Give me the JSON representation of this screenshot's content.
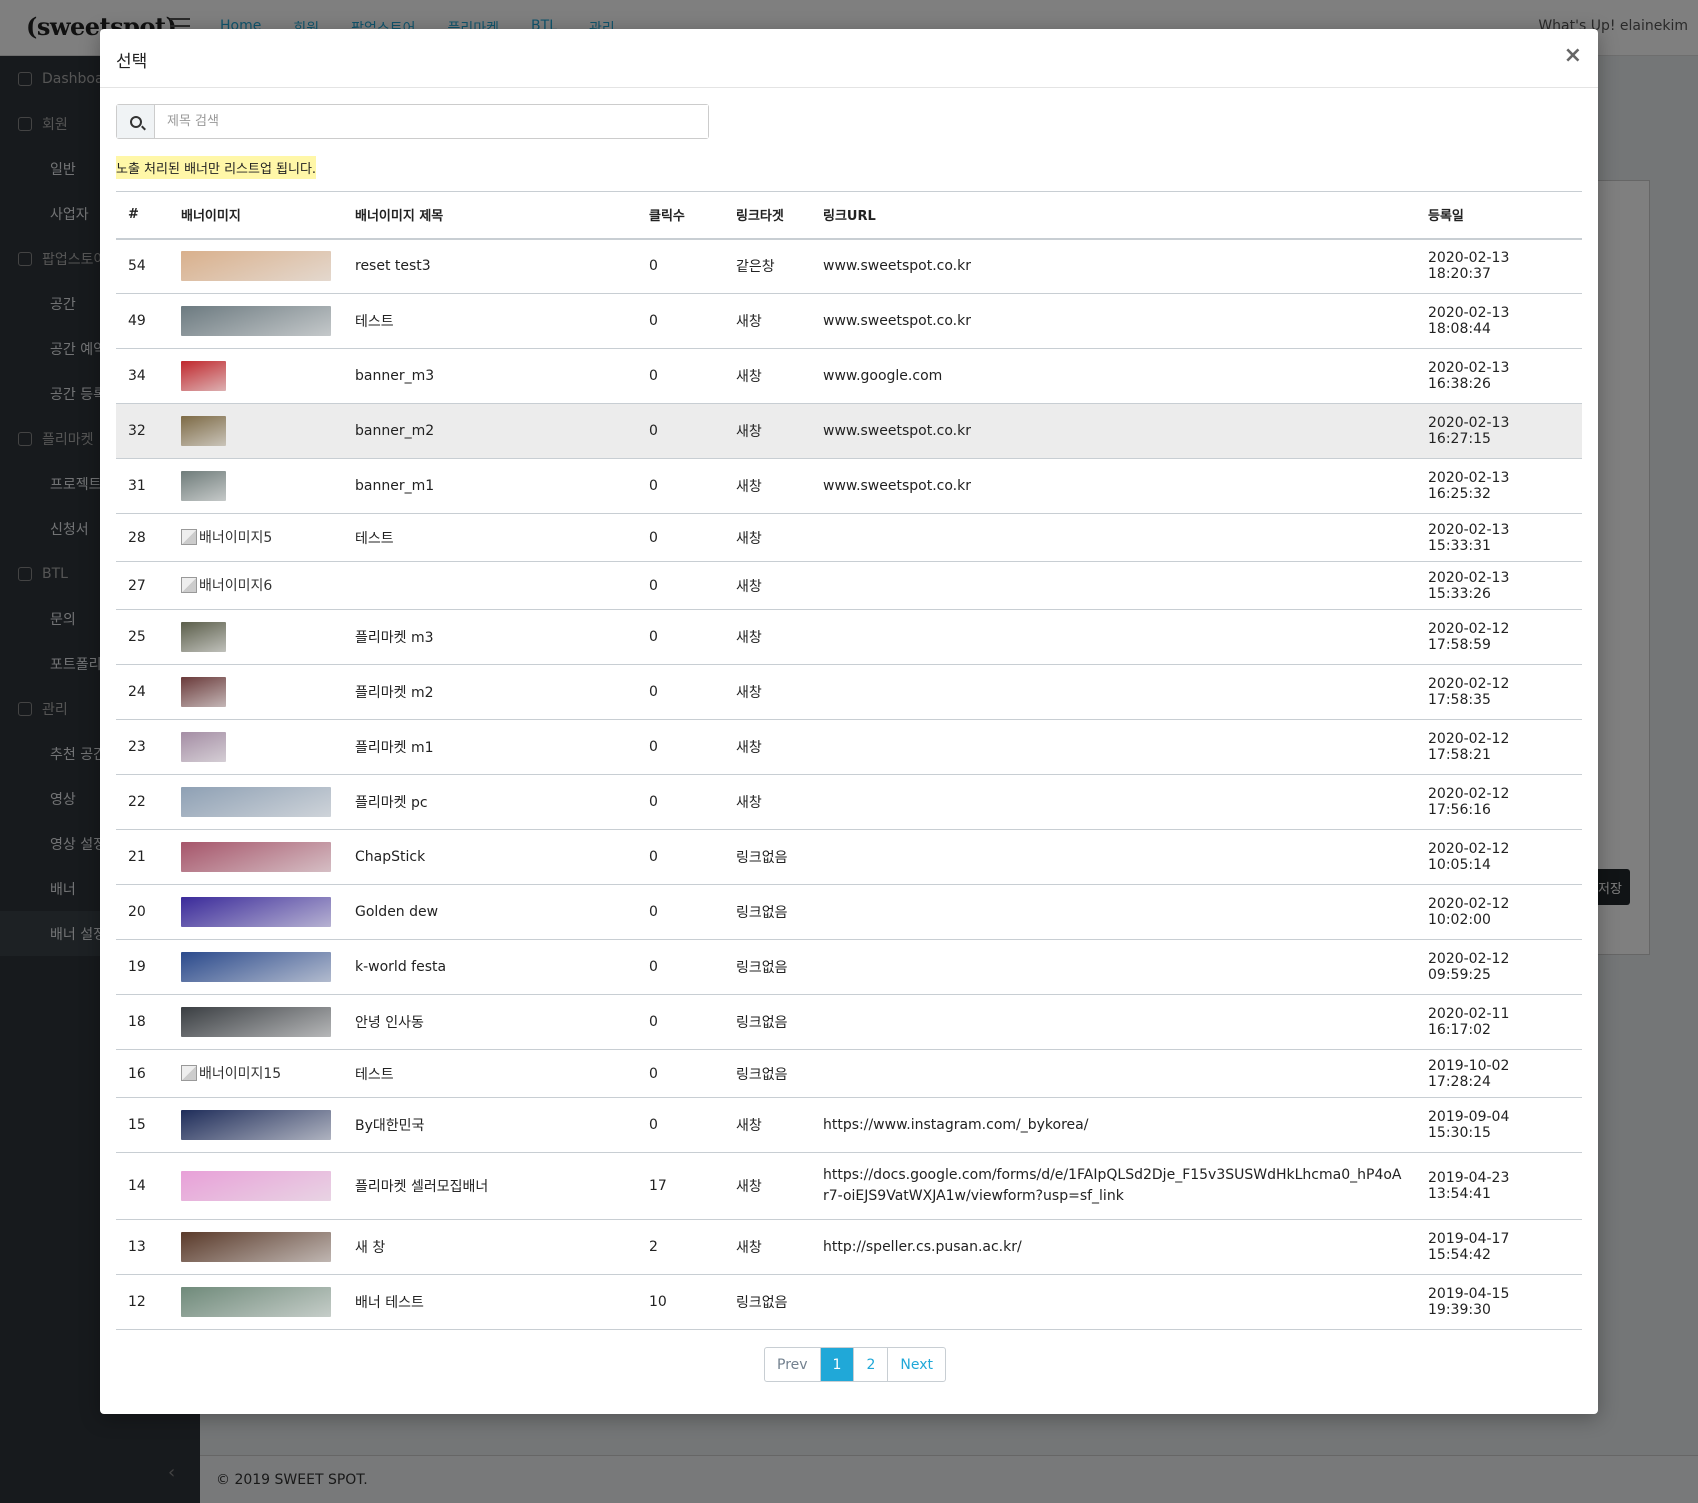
{
  "app": {
    "logo": "(sweetspot)",
    "greeting": "What's Up! elainekim",
    "topnav": [
      "Home",
      "회원",
      "팝업스토어",
      "플리마켓",
      "BTL",
      "관리"
    ],
    "sidebar": [
      {
        "type": "sec",
        "label": "Dashboard"
      },
      {
        "type": "sec",
        "label": "회원"
      },
      {
        "type": "sub",
        "label": "일반"
      },
      {
        "type": "sub",
        "label": "사업자"
      },
      {
        "type": "sec",
        "label": "팝업스토어"
      },
      {
        "type": "sub",
        "label": "공간"
      },
      {
        "type": "sub",
        "label": "공간 예약"
      },
      {
        "type": "sub",
        "label": "공간 등록"
      },
      {
        "type": "sec",
        "label": "플리마켓"
      },
      {
        "type": "sub",
        "label": "프로젝트"
      },
      {
        "type": "sub",
        "label": "신청서"
      },
      {
        "type": "sec",
        "label": "BTL"
      },
      {
        "type": "sub",
        "label": "문의"
      },
      {
        "type": "sub",
        "label": "포트폴리오"
      },
      {
        "type": "sec",
        "label": "관리"
      },
      {
        "type": "sub",
        "label": "추천 공간"
      },
      {
        "type": "sub",
        "label": "영상"
      },
      {
        "type": "sub",
        "label": "영상 설정"
      },
      {
        "type": "sub",
        "label": "배너"
      },
      {
        "type": "sub",
        "label": "배너 설정"
      }
    ],
    "save_button": "저장",
    "footer": "© 2019 SWEET SPOT."
  },
  "modal": {
    "title": "선택",
    "close": "×",
    "search_placeholder": "제목 검색",
    "notice": "노출 처리된 배너만 리스트업 됩니다.",
    "columns": [
      "#",
      "배너이미지",
      "배너이미지 제목",
      "클릭수",
      "링크타겟",
      "링크URL",
      "등록일"
    ],
    "rows": [
      {
        "id": "54",
        "img": "wide",
        "img_color": "#d9b08c",
        "alt": "",
        "title": "reset test3",
        "clicks": "0",
        "target": "같은창",
        "url": "www.sweetspot.co.kr",
        "date": "2020-02-13 18:20:37"
      },
      {
        "id": "49",
        "img": "wide",
        "img_color": "#6c7a80",
        "alt": "",
        "title": "테스트",
        "clicks": "0",
        "target": "새창",
        "url": "www.sweetspot.co.kr",
        "date": "2020-02-13 18:08:44"
      },
      {
        "id": "34",
        "img": "sq",
        "img_color": "#c0282d",
        "alt": "",
        "title": "banner_m3",
        "clicks": "0",
        "target": "새창",
        "url": "www.google.com",
        "date": "2020-02-13 16:38:26"
      },
      {
        "id": "32",
        "img": "sq",
        "img_color": "#7d6a45",
        "alt": "",
        "title": "banner_m2",
        "clicks": "0",
        "target": "새창",
        "url": "www.sweetspot.co.kr",
        "date": "2020-02-13 16:27:15"
      },
      {
        "id": "31",
        "img": "sq",
        "img_color": "#6f7c7a",
        "alt": "",
        "title": "banner_m1",
        "clicks": "0",
        "target": "새창",
        "url": "www.sweetspot.co.kr",
        "date": "2020-02-13 16:25:32"
      },
      {
        "id": "28",
        "img": "broken",
        "img_color": "",
        "alt": "배너이미지5",
        "title": "테스트",
        "clicks": "0",
        "target": "새창",
        "url": "",
        "date": "2020-02-13 15:33:31"
      },
      {
        "id": "27",
        "img": "broken",
        "img_color": "",
        "alt": "배너이미지6",
        "title": "",
        "clicks": "0",
        "target": "새창",
        "url": "",
        "date": "2020-02-13 15:33:26"
      },
      {
        "id": "25",
        "img": "sq",
        "img_color": "#5b5e4a",
        "alt": "",
        "title": "플리마켓 m3",
        "clicks": "0",
        "target": "새창",
        "url": "",
        "date": "2020-02-12 17:58:59"
      },
      {
        "id": "24",
        "img": "sq",
        "img_color": "#6a3a3a",
        "alt": "",
        "title": "플리마켓 m2",
        "clicks": "0",
        "target": "새창",
        "url": "",
        "date": "2020-02-12 17:58:35"
      },
      {
        "id": "23",
        "img": "sq",
        "img_color": "#a48da4",
        "alt": "",
        "title": "플리마켓 m1",
        "clicks": "0",
        "target": "새창",
        "url": "",
        "date": "2020-02-12 17:58:21"
      },
      {
        "id": "22",
        "img": "wide",
        "img_color": "#8ea0b4",
        "alt": "",
        "title": "플리마켓 pc",
        "clicks": "0",
        "target": "새창",
        "url": "",
        "date": "2020-02-12 17:56:16"
      },
      {
        "id": "21",
        "img": "wide",
        "img_color": "#a6556a",
        "alt": "",
        "title": "ChapStick",
        "clicks": "0",
        "target": "링크없음",
        "url": "",
        "date": "2020-02-12 10:05:14"
      },
      {
        "id": "20",
        "img": "wide",
        "img_color": "#3a2a9a",
        "alt": "",
        "title": "Golden dew",
        "clicks": "0",
        "target": "링크없음",
        "url": "",
        "date": "2020-02-12 10:02:00"
      },
      {
        "id": "19",
        "img": "wide",
        "img_color": "#2b4a8c",
        "alt": "",
        "title": "k-world festa",
        "clicks": "0",
        "target": "링크없음",
        "url": "",
        "date": "2020-02-12 09:59:25"
      },
      {
        "id": "18",
        "img": "wide",
        "img_color": "#3a3e42",
        "alt": "",
        "title": "안녕 인사동",
        "clicks": "0",
        "target": "링크없음",
        "url": "",
        "date": "2020-02-11 16:17:02"
      },
      {
        "id": "16",
        "img": "broken",
        "img_color": "",
        "alt": "배너이미지15",
        "title": "테스트",
        "clicks": "0",
        "target": "링크없음",
        "url": "",
        "date": "2019-10-02 17:28:24"
      },
      {
        "id": "15",
        "img": "wide",
        "img_color": "#1f2d5a",
        "alt": "",
        "title": "By대한민국",
        "clicks": "0",
        "target": "새창",
        "url": "https://www.instagram.com/_bykorea/",
        "date": "2019-09-04 15:30:15"
      },
      {
        "id": "14",
        "img": "wide",
        "img_color": "#e8a0d8",
        "alt": "",
        "title": "플리마켓 셀러모집배너",
        "clicks": "17",
        "target": "새창",
        "url": "https://docs.google.com/forms/d/e/1FAIpQLSd2Dje_F15v3SUSWdHkLhcma0_hP4oAr7-oiEJS9VatWXJA1w/viewform?usp=sf_link",
        "date": "2019-04-23 13:54:41"
      },
      {
        "id": "13",
        "img": "wide",
        "img_color": "#5a3a2a",
        "alt": "",
        "title": "새 창",
        "clicks": "2",
        "target": "새창",
        "url": "http://speller.cs.pusan.ac.kr/",
        "date": "2019-04-17 15:54:42"
      },
      {
        "id": "12",
        "img": "wide",
        "img_color": "#6f8a7a",
        "alt": "",
        "title": "배너 테스트",
        "clicks": "10",
        "target": "링크없음",
        "url": "",
        "date": "2019-04-15 19:39:30"
      }
    ],
    "pagination": {
      "prev": "Prev",
      "pages": [
        "1",
        "2"
      ],
      "active": "1",
      "next": "Next"
    }
  }
}
